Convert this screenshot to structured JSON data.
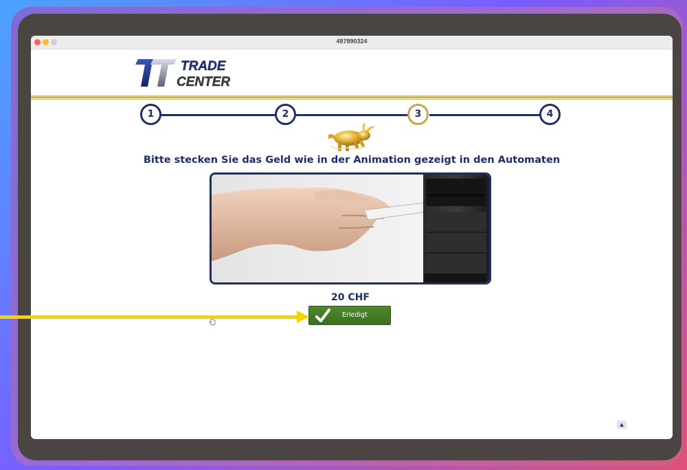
{
  "window": {
    "title": "497890324"
  },
  "brand": {
    "line1": "TRADE",
    "line2": "CENTER",
    "mark": "T"
  },
  "steps": [
    {
      "number": "1",
      "state": "done"
    },
    {
      "number": "2",
      "state": "done"
    },
    {
      "number": "3",
      "state": "active"
    },
    {
      "number": "4",
      "state": "pending"
    }
  ],
  "main": {
    "instruction": "Bitte stecken Sie das Geld wie in der Animation gezeigt in den Automaten",
    "amount": "20 CHF",
    "done_button": "Erledigt"
  },
  "icons": {
    "bull": "golden-bull-icon",
    "check": "checkmark-icon",
    "scroll_top": "up-triangle-icon",
    "cursor": "hand-cursor-icon"
  },
  "colors": {
    "navy": "#1d2d6b",
    "gold": "#c8a44a",
    "green_button": "#3f7422",
    "annotation_arrow": "#f7d300"
  }
}
